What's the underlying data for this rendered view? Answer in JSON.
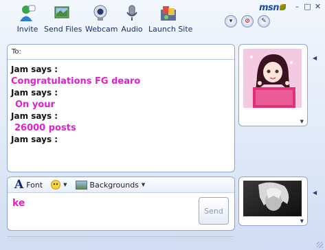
{
  "toolbar": {
    "items": [
      {
        "label": "Invite",
        "icon": "invite-icon"
      },
      {
        "label": "Send Files",
        "icon": "send-files-icon"
      },
      {
        "label": "Webcam",
        "icon": "webcam-icon"
      },
      {
        "label": "Audio",
        "icon": "audio-icon"
      },
      {
        "label": "Launch Site",
        "icon": "launch-site-icon"
      }
    ]
  },
  "brand": {
    "logo_text": "msn"
  },
  "window_controls": {
    "minimize": "–",
    "maximize": "□",
    "close": "✕"
  },
  "conversation": {
    "to_label": "To:",
    "messages": [
      {
        "sender": "Jam says :",
        "text": "Congratulations FG dearo"
      },
      {
        "sender": "Jam says :",
        "text": "On your"
      },
      {
        "sender": "Jam says :",
        "text": "26000 posts"
      },
      {
        "sender": "Jam says :",
        "text": ""
      }
    ]
  },
  "compose": {
    "font_label": "Font",
    "backgrounds_label": "Backgrounds",
    "input_text": "ke",
    "send_label": "Send"
  },
  "colors": {
    "accent_text": "#e020d0",
    "frame_border": "#8ea4cf"
  }
}
